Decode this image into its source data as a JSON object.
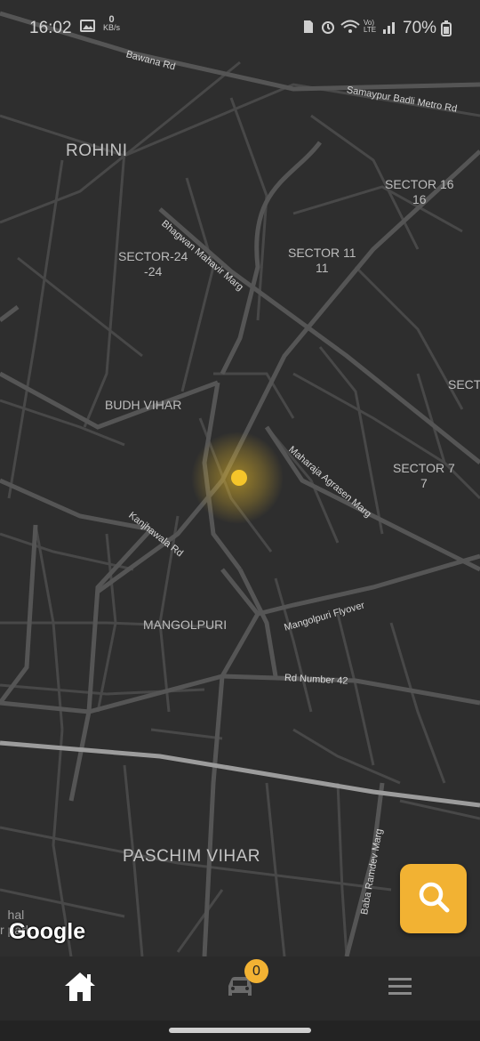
{
  "status_bar": {
    "time": "16:02",
    "network_speed_value": "0",
    "network_speed_unit": "KB/s",
    "network_type": "Vo) LTE",
    "battery": "70%"
  },
  "map": {
    "provider": "Google",
    "area_labels": {
      "rohini": "ROHINI",
      "sector24": "SECTOR-24\n-24",
      "sector11": "SECTOR 11\n11",
      "sector16": "SECTOR 16\n16",
      "sector_partial": "SECTO",
      "budh_vihar": "BUDH VIHAR",
      "sector7": "SECTOR 7\n7",
      "mangolpuri": "MANGOLPURI",
      "paschim_vihar": "PASCHIM VIHAR",
      "park_fragment": "hal\nr park"
    },
    "road_labels": {
      "bawana": "Bawana Rd",
      "samaypur": "Samaypur Badli Metro Rd",
      "bhagwan": "Bhagwan Mahavir Marg",
      "maharaja": "Maharaja Agrasen Marg",
      "kanjhawala": "Kanjhawala Rd",
      "mangolpuri_flyover": "Mangolpuri Flyover",
      "rd42": "Rd Number 42",
      "baba_ramdev": "Baba Ramdev Marg"
    },
    "location_marker_color": "#f5c52a"
  },
  "search_button": {
    "icon": "search-icon",
    "color": "#f2b233"
  },
  "bottom_nav": {
    "items": [
      {
        "name": "home",
        "icon": "home-icon"
      },
      {
        "name": "rides",
        "icon": "car-icon",
        "badge": "0"
      },
      {
        "name": "menu",
        "icon": "hamburger-menu-icon"
      }
    ]
  }
}
